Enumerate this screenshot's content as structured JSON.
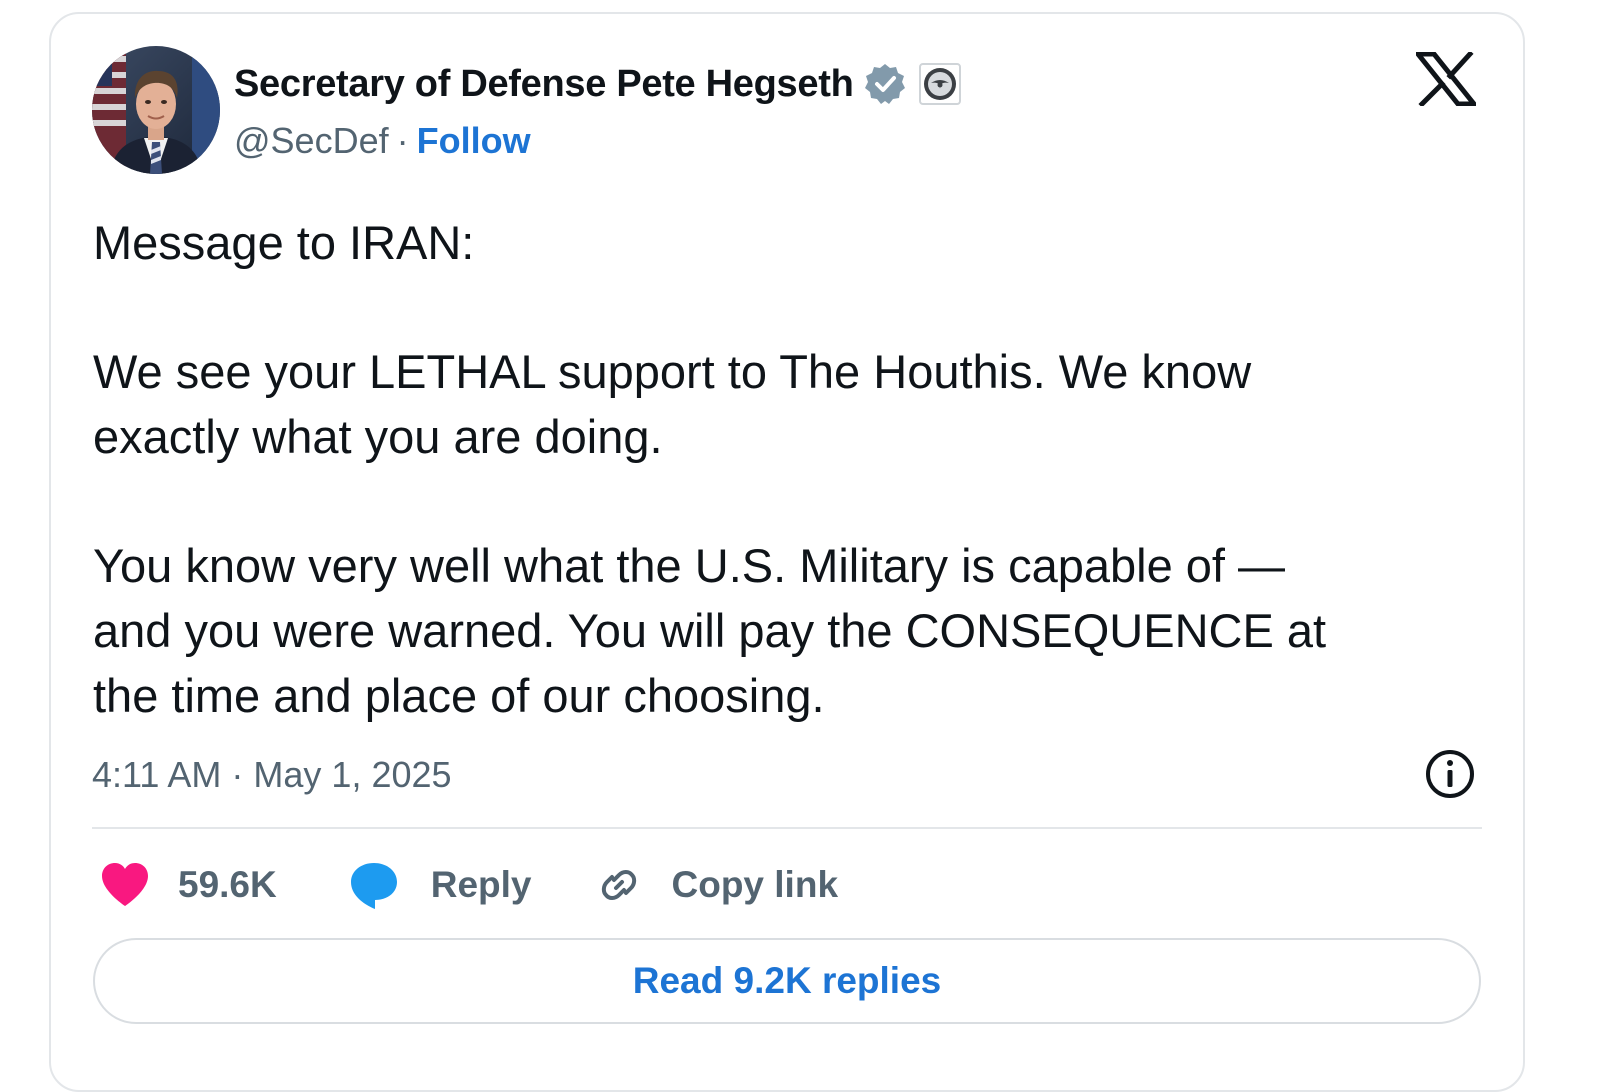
{
  "author": {
    "display_name": "Secretary of Defense Pete Hegseth",
    "handle": "@SecDef",
    "separator": "·",
    "follow_label": "Follow",
    "verified_icon": "verified-badge-icon",
    "affiliation_icon": "dod-seal-icon"
  },
  "platform": {
    "logo_icon": "x-logo-icon"
  },
  "tweet": {
    "paragraphs": [
      {
        "lines": [
          "Message to IRAN:"
        ]
      },
      {
        "lines": [
          "We see your LETHAL support to The Houthis. We know",
          "exactly what you are doing."
        ]
      },
      {
        "lines": [
          "You know very well what the U.S. Military is capable of —",
          "and you were warned. You will pay the CONSEQUENCE at",
          "the time and place of our choosing."
        ]
      }
    ],
    "time": "4:11 AM",
    "date": "May 1, 2025"
  },
  "actions": {
    "like_count": "59.6K",
    "reply_label": "Reply",
    "copy_link_label": "Copy link"
  },
  "replies_button": {
    "label": "Read 9.2K replies"
  },
  "colors": {
    "like": "#f91880",
    "reply": "#1d9bf0",
    "link": "#1d74d4",
    "muted": "#536471",
    "verified": "#829aab"
  }
}
